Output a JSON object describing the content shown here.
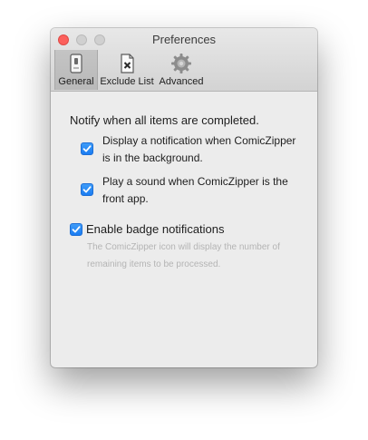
{
  "window": {
    "title": "Preferences"
  },
  "tabs": [
    {
      "label": "General",
      "icon": "switch-icon",
      "selected": true
    },
    {
      "label": "Exclude List",
      "icon": "document-x-icon",
      "selected": false
    },
    {
      "label": "Advanced",
      "icon": "gear-icon",
      "selected": false
    }
  ],
  "general": {
    "heading": "Notify when all items are completed.",
    "options": [
      {
        "line1": "Display a notification when ComicZipper",
        "line2": "is in the background.",
        "checked": true
      },
      {
        "line1": "Play a sound when ComicZipper is the",
        "line2": "front app.",
        "checked": true
      }
    ],
    "badge": {
      "label": "Enable badge notifications",
      "checked": true,
      "help_line1": "The ComicZipper icon will display the number of",
      "help_line2": "remaining items to be processed."
    }
  },
  "colors": {
    "accent": "#1a7cf2",
    "close": "#fc605c"
  }
}
